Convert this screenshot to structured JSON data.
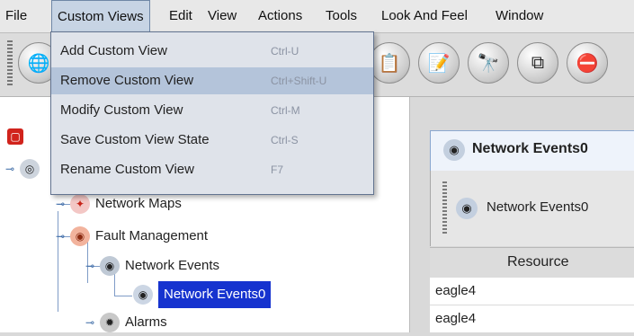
{
  "menubar": {
    "items": [
      "File",
      "Custom Views",
      "Edit",
      "View",
      "Actions",
      "Tools",
      "Look And Feel",
      "Window"
    ]
  },
  "dropdown": {
    "items": [
      {
        "label": "Add Custom View",
        "shortcut": "Ctrl-U"
      },
      {
        "label": "Remove Custom View",
        "shortcut": "Ctrl+Shift-U"
      },
      {
        "label": "Modify Custom View",
        "shortcut": "Ctrl-M"
      },
      {
        "label": "Save Custom View State",
        "shortcut": "Ctrl-S"
      },
      {
        "label": "Rename Custom View",
        "shortcut": "F7"
      }
    ]
  },
  "tree": {
    "items": [
      "Network Maps",
      "Fault Management",
      "Network Events",
      "Network Events0",
      "Alarms"
    ]
  },
  "right_panel": {
    "title": "Network Events0",
    "strip_label": "Network Events0",
    "column_header": "Resource",
    "rows": [
      "eagle4",
      "eagle4"
    ]
  },
  "colors": {
    "selection": "#1633cf",
    "menu_highlight": "#b4c4da"
  },
  "icons": {
    "toolbar": [
      "globe-icon",
      "properties-icon",
      "edit-icon",
      "binoculars-icon",
      "window-icon",
      "stop-icon"
    ]
  }
}
